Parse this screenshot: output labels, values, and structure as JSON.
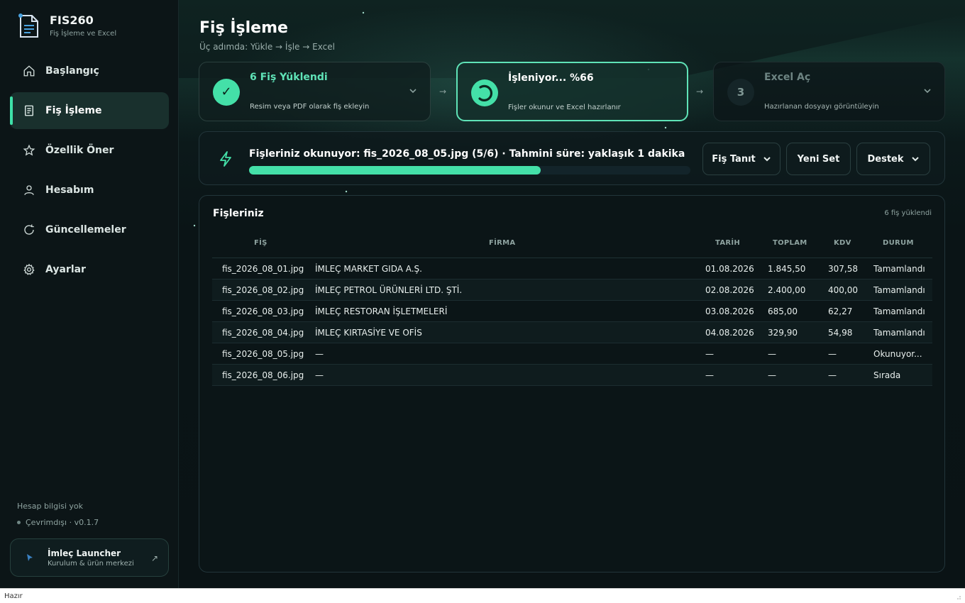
{
  "app": {
    "name": "FIS260",
    "tagline": "Fiş İşleme ve Excel"
  },
  "nav": [
    {
      "label": "Başlangıç",
      "icon": "home-icon",
      "active": false
    },
    {
      "label": "Fiş İşleme",
      "icon": "document-icon",
      "active": true
    },
    {
      "label": "Özellik Öner",
      "icon": "star-icon",
      "active": false
    },
    {
      "label": "Hesabım",
      "icon": "user-icon",
      "active": false
    },
    {
      "label": "Güncellemeler",
      "icon": "refresh-icon",
      "active": false
    },
    {
      "label": "Ayarlar",
      "icon": "gear-icon",
      "active": false
    }
  ],
  "account": {
    "info": "Hesap bilgisi yok",
    "status": "Çevrimdışı · v0.1.7"
  },
  "launcher": {
    "title": "İmleç Launcher",
    "subtitle": "Kurulum & ürün merkezi",
    "arrow": "↗"
  },
  "page": {
    "title": "Fiş İşleme",
    "subtitle": "Üç adımda: Yükle → İşle → Excel"
  },
  "steps": [
    {
      "badge": "✓",
      "title": "6 Fiş Yüklendi",
      "desc": "Resim veya PDF olarak fiş ekleyin",
      "state": "done"
    },
    {
      "badge": "",
      "title": "İşleniyor...  %66",
      "desc": "Fişler okunur ve Excel hazırlanır",
      "state": "active"
    },
    {
      "badge": "3",
      "title": "Excel Aç",
      "desc": "Hazırlanan dosyayı görüntüleyin",
      "state": "pending"
    }
  ],
  "step_arrow": "→",
  "progress": {
    "text": "Fişleriniz okunuyor: fis_2026_08_05.jpg (5/6) · Tahmini süre: yaklaşık 1 dakika",
    "fraction": 0.66
  },
  "buttons": {
    "identify": "Fiş Tanıt",
    "new_set": "Yeni Set",
    "support": "Destek"
  },
  "table": {
    "title": "Fişleriniz",
    "count": "6 fiş yüklendi",
    "columns": [
      "FİŞ",
      "FİRMA",
      "TARİH",
      "TOPLAM",
      "KDV",
      "DURUM"
    ],
    "rows": [
      [
        "fis_2026_08_01.jpg",
        "İMLEÇ MARKET GIDA A.Ş.",
        "01.08.2026",
        "1.845,50",
        "307,58",
        "Tamamlandı"
      ],
      [
        "fis_2026_08_02.jpg",
        "İMLEÇ PETROL ÜRÜNLERİ LTD. ŞTİ.",
        "02.08.2026",
        "2.400,00",
        "400,00",
        "Tamamlandı"
      ],
      [
        "fis_2026_08_03.jpg",
        "İMLEÇ RESTORAN İŞLETMELERİ",
        "03.08.2026",
        "685,00",
        "62,27",
        "Tamamlandı"
      ],
      [
        "fis_2026_08_04.jpg",
        "İMLEÇ KIRTASİYE VE OFİS",
        "04.08.2026",
        "329,90",
        "54,98",
        "Tamamlandı"
      ],
      [
        "fis_2026_08_05.jpg",
        "—",
        "—",
        "—",
        "—",
        "Okunuyor..."
      ],
      [
        "fis_2026_08_06.jpg",
        "—",
        "—",
        "—",
        "—",
        "Sırada"
      ]
    ]
  },
  "statusbar": {
    "text": "Hazır"
  },
  "colors": {
    "accent": "#44e0a8",
    "background": "#0b1416",
    "active_nav": "#19302d"
  }
}
